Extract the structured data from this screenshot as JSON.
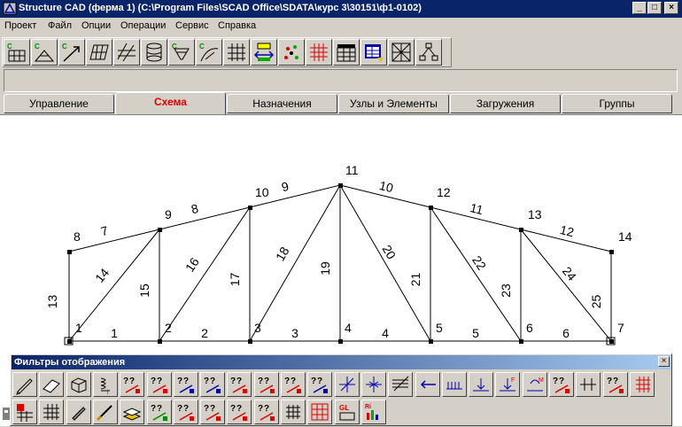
{
  "window": {
    "title": "Structure CAD (ферма 1) (C:\\Program Files\\SCAD Office\\SDATA\\курс 3\\30151\\ф1-0102)",
    "minimize_glyph": "_",
    "maximize_glyph": "□",
    "close_glyph": "×"
  },
  "menu": [
    "Проект",
    "Файл",
    "Опции",
    "Операции",
    "Сервис",
    "Справка"
  ],
  "toolbar": {
    "icons": [
      "new-scheme-icon",
      "new-scheme-2-icon",
      "scheme-arrow-icon",
      "plane-grid-icon",
      "diagonal-grid-icon",
      "cylinder-icon",
      "funnel-icon",
      "curve-icon",
      "grid-insert-icon",
      "align-icon",
      "node-cloud-icon",
      "grid-mesh-icon",
      "table-grid-icon",
      "calc-table-icon",
      "frame-box-icon",
      "tree-icon"
    ]
  },
  "tabs": [
    {
      "label": "Управление",
      "active": false
    },
    {
      "label": "Схема",
      "active": true
    },
    {
      "label": "Назначения",
      "active": false
    },
    {
      "label": "Узлы и Элементы",
      "active": false
    },
    {
      "label": "Загружения",
      "active": false
    },
    {
      "label": "Группы",
      "active": false
    }
  ],
  "truss": {
    "nodes": [
      {
        "id": "1"
      },
      {
        "id": "2"
      },
      {
        "id": "3"
      },
      {
        "id": "4"
      },
      {
        "id": "5"
      },
      {
        "id": "6"
      },
      {
        "id": "7"
      },
      {
        "id": "8"
      },
      {
        "id": "9"
      },
      {
        "id": "10"
      },
      {
        "id": "11"
      },
      {
        "id": "12"
      },
      {
        "id": "13"
      },
      {
        "id": "14"
      }
    ],
    "elements": [
      {
        "id": "1",
        "from": "1",
        "to": "2"
      },
      {
        "id": "2",
        "from": "2",
        "to": "3"
      },
      {
        "id": "3",
        "from": "3",
        "to": "4"
      },
      {
        "id": "4",
        "from": "4",
        "to": "5"
      },
      {
        "id": "5",
        "from": "5",
        "to": "6"
      },
      {
        "id": "6",
        "from": "6",
        "to": "7"
      },
      {
        "id": "7",
        "from": "8",
        "to": "9"
      },
      {
        "id": "8",
        "from": "9",
        "to": "10"
      },
      {
        "id": "9",
        "from": "10",
        "to": "11"
      },
      {
        "id": "10",
        "from": "11",
        "to": "12"
      },
      {
        "id": "11",
        "from": "12",
        "to": "13"
      },
      {
        "id": "12",
        "from": "13",
        "to": "14"
      },
      {
        "id": "13",
        "from": "1",
        "to": "8"
      },
      {
        "id": "14",
        "from": "1",
        "to": "9"
      },
      {
        "id": "15",
        "from": "2",
        "to": "9"
      },
      {
        "id": "16",
        "from": "2",
        "to": "10"
      },
      {
        "id": "17",
        "from": "3",
        "to": "10"
      },
      {
        "id": "18",
        "from": "3",
        "to": "11"
      },
      {
        "id": "19",
        "from": "4",
        "to": "11"
      },
      {
        "id": "20",
        "from": "11",
        "to": "5"
      },
      {
        "id": "21",
        "from": "5",
        "to": "12"
      },
      {
        "id": "22",
        "from": "12",
        "to": "6"
      },
      {
        "id": "23",
        "from": "6",
        "to": "13"
      },
      {
        "id": "24",
        "from": "13",
        "to": "7"
      },
      {
        "id": "25",
        "from": "7",
        "to": "14"
      }
    ]
  },
  "palette": {
    "title": "Фильтры отображения",
    "close_glyph": "×",
    "row1_icons": [
      "pencil-icon",
      "eraser-icon",
      "box-3d-icon",
      "spring-icon",
      "query-i-icon",
      "query-i-cross-icon",
      "query-ne-icon",
      "query-nj-icon",
      "query-e-icon",
      "query-r-icon",
      "query-support-icon",
      "query-nodes-icon",
      "cross-axes-icon",
      "cross-axes-arrows-icon",
      "hatch-icon",
      "arrow-left-icon",
      "load-bar-icon",
      "load-bar-down-icon",
      "load-force-icon",
      "load-moment-icon",
      "query-m-icon",
      "divider-icon",
      "query-y-icon",
      "grid-corner-icon"
    ],
    "row2_icons": [
      "grid-table-icon",
      "grid-dots-icon",
      "pencil-bar-icon",
      "brush-icon",
      "layers-icon",
      "query-node-numbers-icon",
      "query-n-icon",
      "query-g-icon",
      "query-g-arrow-icon",
      "query-g-cross-icon",
      "frame-grid-icon",
      "red-grid-icon",
      "gl-icon",
      "ri-chart-icon"
    ]
  }
}
